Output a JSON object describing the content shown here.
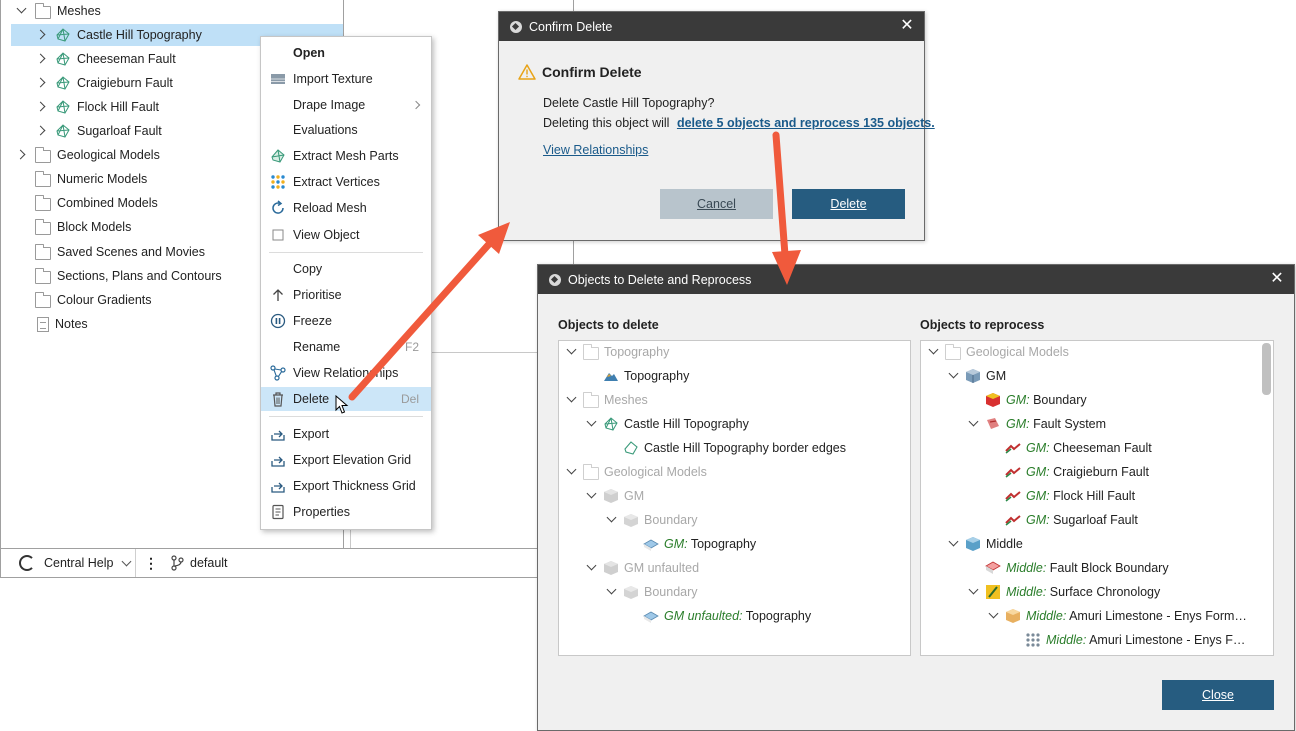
{
  "tree": {
    "items": [
      {
        "label": "Meshes",
        "expander": "down",
        "icon": "folder-icon"
      },
      {
        "label": "Castle Hill Topography",
        "expander": "right",
        "icon": "mesh-icon",
        "selected": true
      },
      {
        "label": "Cheeseman Fault",
        "expander": "right",
        "icon": "mesh-icon"
      },
      {
        "label": "Craigieburn Fault",
        "expander": "right",
        "icon": "mesh-icon"
      },
      {
        "label": "Flock Hill Fault",
        "expander": "right",
        "icon": "mesh-icon"
      },
      {
        "label": "Sugarloaf Fault",
        "expander": "right",
        "icon": "mesh-icon"
      },
      {
        "label": "Geological Models",
        "expander": "right",
        "icon": "folder-icon"
      },
      {
        "label": "Numeric Models",
        "expander": "none",
        "icon": "folder-icon"
      },
      {
        "label": "Combined Models",
        "expander": "none",
        "icon": "folder-icon"
      },
      {
        "label": "Block Models",
        "expander": "none",
        "icon": "folder-icon"
      },
      {
        "label": "Saved Scenes and Movies",
        "expander": "none",
        "icon": "folder-icon"
      },
      {
        "label": "Sections, Plans and Contours",
        "expander": "none",
        "icon": "folder-icon"
      },
      {
        "label": "Colour Gradients",
        "expander": "none",
        "icon": "folder-icon"
      },
      {
        "label": "Notes",
        "expander": "none",
        "icon": "notes-icon"
      }
    ]
  },
  "statusbar": {
    "help_label": "Central Help",
    "menu_glyph": "⋮",
    "branch_label": "default"
  },
  "context_menu": {
    "items": [
      {
        "label": "Open",
        "bold": true,
        "icon": "none"
      },
      {
        "label": "Import Texture",
        "icon": "import-texture-icon"
      },
      {
        "label": "Drape Image",
        "icon": "none",
        "submenu": true
      },
      {
        "label": "Evaluations",
        "icon": "none"
      },
      {
        "label": "Extract Mesh Parts",
        "icon": "extract-mesh-icon"
      },
      {
        "label": "Extract Vertices",
        "icon": "vertices-icon"
      },
      {
        "label": "Reload Mesh",
        "icon": "reload-icon"
      },
      {
        "label": "View Object",
        "icon": "checkbox-icon"
      },
      {
        "label": "Copy",
        "icon": "none"
      },
      {
        "label": "Prioritise",
        "icon": "up-arrow-icon"
      },
      {
        "label": "Freeze",
        "icon": "pause-icon"
      },
      {
        "label": "Rename",
        "icon": "none",
        "shortcut": "F2"
      },
      {
        "label": "View Relationships",
        "icon": "relationships-icon"
      },
      {
        "label": "Delete",
        "icon": "trash-icon",
        "shortcut": "Del",
        "active": true
      },
      {
        "label": "Export",
        "icon": "export-icon"
      },
      {
        "label": "Export Elevation Grid",
        "icon": "export-icon"
      },
      {
        "label": "Export Thickness Grid",
        "icon": "export-icon"
      },
      {
        "label": "Properties",
        "icon": "properties-icon"
      }
    ]
  },
  "confirm_dialog": {
    "title": "Confirm Delete",
    "heading": "Confirm Delete",
    "line1": "Delete Castle Hill Topography?",
    "line2_prefix": "Deleting this object will",
    "line2_link": "delete 5 objects and reprocess 135 objects.",
    "view_relationships": "View Relationships",
    "cancel_label": "Cancel",
    "delete_label": "Delete"
  },
  "reprocess_dialog": {
    "title": "Objects to Delete and Reprocess",
    "delete_header": "Objects to delete",
    "reprocess_header": "Objects to reprocess",
    "close_label": "Close",
    "delete_rows": [
      {
        "depth": 0,
        "expander": "down",
        "icon": "folder-icon",
        "prefix": "",
        "text": "Topography",
        "grey": true
      },
      {
        "depth": 1,
        "expander": "none",
        "icon": "topography-icon",
        "prefix": "",
        "text": "Topography",
        "grey": false
      },
      {
        "depth": 0,
        "expander": "down",
        "icon": "folder-icon",
        "prefix": "",
        "text": "Meshes",
        "grey": true
      },
      {
        "depth": 1,
        "expander": "down",
        "icon": "mesh-icon",
        "prefix": "",
        "text": "Castle Hill Topography",
        "grey": false
      },
      {
        "depth": 2,
        "expander": "none",
        "icon": "polyline-icon",
        "prefix": "",
        "text": "Castle Hill Topography border edges",
        "grey": false
      },
      {
        "depth": 0,
        "expander": "down",
        "icon": "folder-icon",
        "prefix": "",
        "text": "Geological Models",
        "grey": true
      },
      {
        "depth": 1,
        "expander": "down",
        "icon": "gm-icon",
        "prefix": "",
        "text": "GM",
        "grey": true
      },
      {
        "depth": 2,
        "expander": "down",
        "icon": "boundary-icon",
        "prefix": "",
        "text": "Boundary",
        "grey": true
      },
      {
        "depth": 3,
        "expander": "none",
        "icon": "surface-icon",
        "prefix": "GM:",
        "text": "Topography",
        "grey": false
      },
      {
        "depth": 1,
        "expander": "down",
        "icon": "gm-icon",
        "prefix": "",
        "text": "GM unfaulted",
        "grey": true
      },
      {
        "depth": 2,
        "expander": "down",
        "icon": "boundary-icon",
        "prefix": "",
        "text": "Boundary",
        "grey": true
      },
      {
        "depth": 3,
        "expander": "none",
        "icon": "surface-icon",
        "prefix": "GM unfaulted:",
        "text": "Topography",
        "grey": false
      }
    ],
    "reprocess_rows": [
      {
        "depth": 0,
        "expander": "down",
        "icon": "folder-icon",
        "prefix": "",
        "text": "Geological Models",
        "grey": true
      },
      {
        "depth": 1,
        "expander": "down",
        "icon": "gm-icon-color",
        "prefix": "",
        "text": "GM",
        "grey": false
      },
      {
        "depth": 2,
        "expander": "none",
        "icon": "boundary-color-icon",
        "prefix": "GM:",
        "text": "Boundary",
        "grey": false
      },
      {
        "depth": 2,
        "expander": "down",
        "icon": "fault-system-icon",
        "prefix": "GM:",
        "text": "Fault System",
        "grey": false
      },
      {
        "depth": 3,
        "expander": "none",
        "icon": "fault-icon",
        "prefix": "GM:",
        "text": "Cheeseman Fault",
        "grey": false
      },
      {
        "depth": 3,
        "expander": "none",
        "icon": "fault-icon",
        "prefix": "GM:",
        "text": "Craigieburn Fault",
        "grey": false
      },
      {
        "depth": 3,
        "expander": "none",
        "icon": "fault-icon",
        "prefix": "GM:",
        "text": "Flock Hill Fault",
        "grey": false
      },
      {
        "depth": 3,
        "expander": "none",
        "icon": "fault-icon",
        "prefix": "GM:",
        "text": "Sugarloaf Fault",
        "grey": false
      },
      {
        "depth": 1,
        "expander": "down",
        "icon": "block-icon",
        "prefix": "",
        "text": "Middle",
        "grey": false
      },
      {
        "depth": 2,
        "expander": "none",
        "icon": "fault-block-boundary-icon",
        "prefix": "Middle:",
        "text": "Fault Block Boundary",
        "grey": false
      },
      {
        "depth": 2,
        "expander": "down",
        "icon": "chronology-icon",
        "prefix": "Middle:",
        "text": "Surface Chronology",
        "grey": false
      },
      {
        "depth": 3,
        "expander": "down",
        "icon": "contact-icon",
        "prefix": "Middle:",
        "text": "Amuri Limestone - Enys Form…",
        "grey": false
      },
      {
        "depth": 4,
        "expander": "none",
        "icon": "points-icon",
        "prefix": "Middle:",
        "text": "Amuri Limestone - Enys F…",
        "grey": false
      }
    ]
  },
  "colors": {
    "accent": "#265c80",
    "selection": "#bfe0f7",
    "arrow": "#f05a3c",
    "titlebar": "#3a3a3a",
    "prefix_green": "#2a7d2a"
  }
}
